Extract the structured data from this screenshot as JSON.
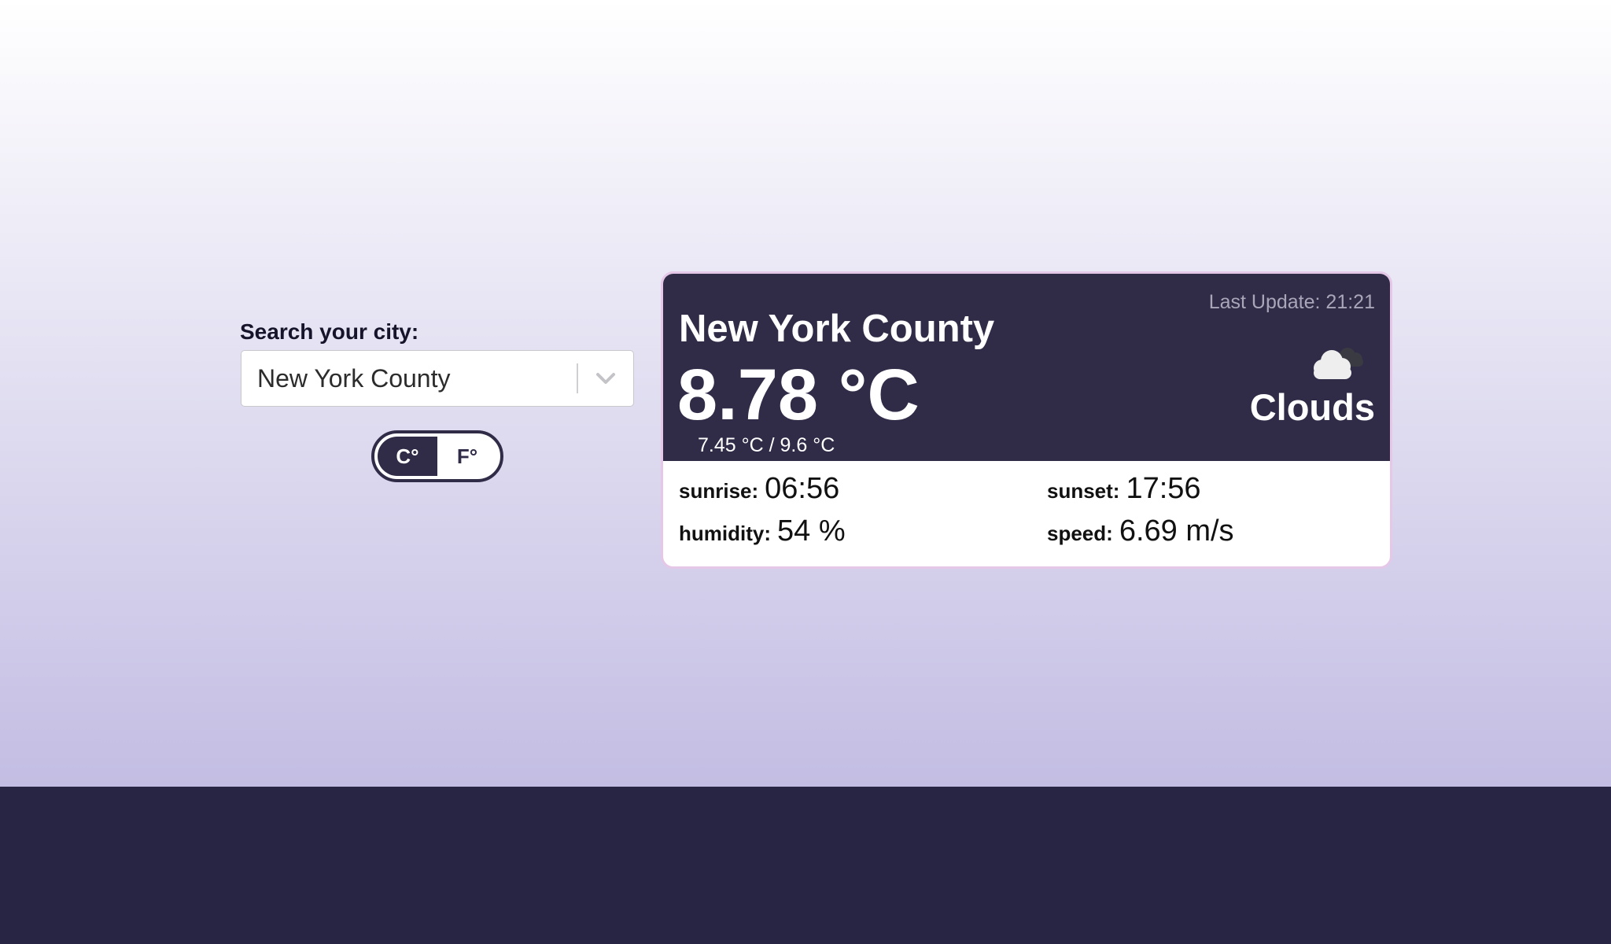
{
  "search": {
    "label": "Search your city:",
    "selected_city": "New York County"
  },
  "units_toggle": {
    "celsius_label": "C°",
    "fahrenheit_label": "F°",
    "active": "C°"
  },
  "weather": {
    "last_update": "Last Update: 21:21",
    "city": "New York County",
    "temperature": "8.78 °C",
    "temp_range": "7.45 °C / 9.6 °C",
    "condition": "Clouds",
    "icon": "cloud-icon",
    "stats": {
      "sunrise_label": "sunrise:",
      "sunrise_value": "06:56",
      "sunset_label": "sunset:",
      "sunset_value": "17:56",
      "humidity_label": "humidity:",
      "humidity_value": "54 %",
      "speed_label": "speed:",
      "speed_value": "6.69 m/s"
    }
  },
  "colors": {
    "card_dark": "#302c48",
    "footer": "#282443",
    "card_border": "#e5c7e8",
    "gradient_bottom": "#c3bde3"
  }
}
